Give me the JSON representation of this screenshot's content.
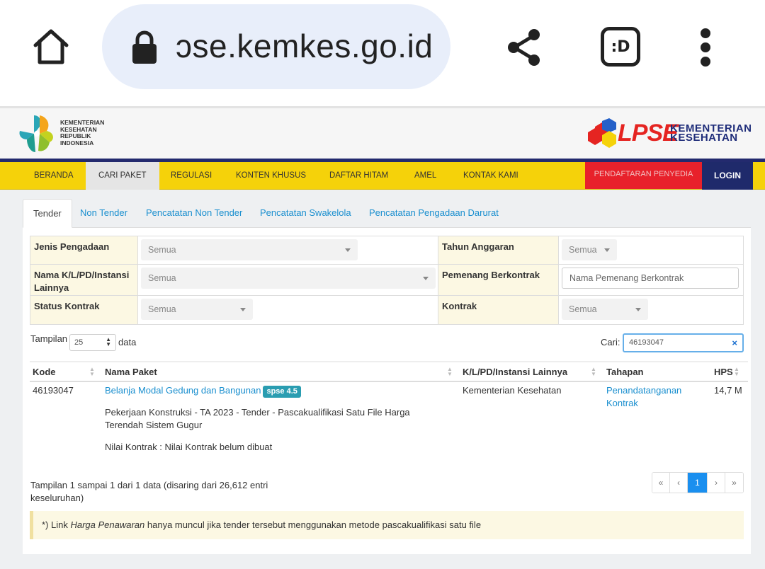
{
  "browser": {
    "url": "ɔse.kemkes.go.id",
    "ext_label": ":D"
  },
  "header": {
    "org_lines": [
      "KEMENTERIAN",
      "KESEHATAN",
      "REPUBLIK",
      "INDONESIA"
    ],
    "lpse_word": "LPSE",
    "lpse_sub_1": "KEMENTERIAN",
    "lpse_sub_2": "KESEHATAN"
  },
  "nav": {
    "items": [
      "BERANDA",
      "CARI PAKET",
      "REGULASI",
      "KONTEN KHUSUS",
      "DAFTAR HITAM",
      "AMEL",
      "KONTAK KAMI"
    ],
    "active_index": 1,
    "daftar_label": "PENDAFTARAN PENYEDIA",
    "login_label": "LOGIN"
  },
  "tabs": [
    "Tender",
    "Non Tender",
    "Pencatatan Non Tender",
    "Pencatatan Swakelola",
    "Pencatatan Pengadaan Darurat"
  ],
  "filters": {
    "jenis_label": "Jenis Pengadaan",
    "jenis_value": "Semua",
    "tahun_label": "Tahun Anggaran",
    "tahun_value": "Semua",
    "instansi_label": "Nama K/L/PD/Instansi Lainnya",
    "instansi_value": "Semua",
    "pemenang_label": "Pemenang Berkontrak",
    "pemenang_placeholder": "Nama Pemenang Berkontrak",
    "status_label": "Status Kontrak",
    "status_value": "Semua",
    "kontrak_label": "Kontrak",
    "kontrak_value": "Semua"
  },
  "table_controls": {
    "show_label": "Tampilan",
    "show_value": "25",
    "show_after": "data",
    "search_label": "Cari:",
    "search_value": "46193047",
    "clear_label": "×"
  },
  "table": {
    "headers": [
      "Kode",
      "Nama Paket",
      "K/L/PD/Instansi Lainnya",
      "Tahapan",
      "HPS"
    ],
    "rows": [
      {
        "kode": "46193047",
        "nama": "Belanja Modal Gedung dan Bangunan",
        "badge": "spse 4.5",
        "desc": "Pekerjaan Konstruksi - TA 2023 - Tender - Pascakualifikasi Satu File Harga Terendah Sistem Gugur",
        "nilai": "Nilai Kontrak : Nilai Kontrak belum dibuat",
        "instansi": "Kementerian Kesehatan",
        "tahapan": "Penandatanganan Kontrak",
        "hps": "14,7 M"
      }
    ]
  },
  "info_text": "Tampilan 1 sampai 1 dari 1 data (disaring dari 26,612 entri keseluruhan)",
  "pager": [
    "«",
    "‹",
    "1",
    "›",
    "»"
  ],
  "note": {
    "prefix": "*) Link ",
    "emph": "Harga Penawaran",
    "suffix": " hanya muncul jika tender tersebut menggunakan metode pascakualifikasi satu file"
  },
  "colors": {
    "nav_yellow": "#f5d20a",
    "nav_dark": "#232a6e",
    "daftar_red": "#e8212b",
    "link_blue": "#1a8fcf",
    "badge_teal": "#2a9db1"
  }
}
